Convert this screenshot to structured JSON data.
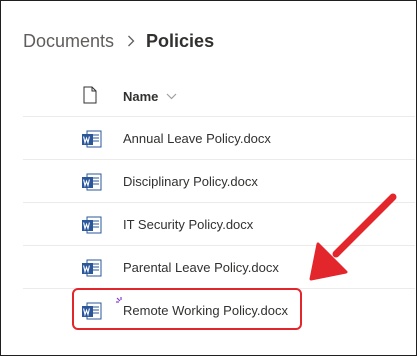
{
  "breadcrumb": {
    "parent": "Documents",
    "current": "Policies"
  },
  "list": {
    "header_name": "Name",
    "files": [
      {
        "name": "Annual Leave Policy.docx",
        "icon": "word-doc-icon"
      },
      {
        "name": "Disciplinary Policy.docx",
        "icon": "word-doc-icon"
      },
      {
        "name": "IT Security Policy.docx",
        "icon": "word-doc-icon"
      },
      {
        "name": "Parental Leave Policy.docx",
        "icon": "word-doc-icon"
      },
      {
        "name": "Remote Working Policy.docx",
        "icon": "word-doc-icon"
      }
    ]
  },
  "colors": {
    "annotation": "#e3262c",
    "word_blue": "#2b579a"
  }
}
